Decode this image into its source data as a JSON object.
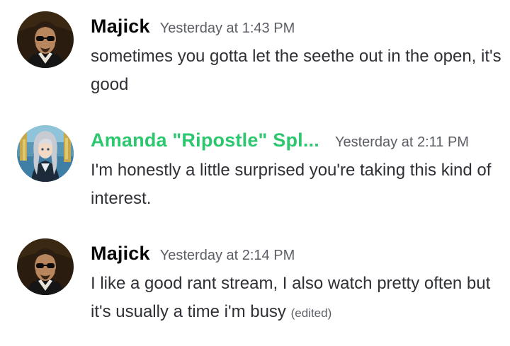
{
  "messages": [
    {
      "author": "Majick",
      "avatar_icon": "majick-avatar",
      "timestamp": "Yesterday at 1:43 PM",
      "text": "sometimes you gotta let the seethe out in the open, it's good",
      "edited": ""
    },
    {
      "author": "Amanda \"Ripostle\" Spl...",
      "author_color": "#2dc770",
      "avatar_icon": "amanda-avatar",
      "timestamp": "Yesterday at 2:11 PM",
      "text": "I'm honestly a little surprised you're taking this kind of interest.",
      "edited": ""
    },
    {
      "author": "Majick",
      "avatar_icon": "majick-avatar",
      "timestamp": "Yesterday at 2:14 PM",
      "text": "I like a good rant stream, I also watch pretty often but it's usually a time i'm busy",
      "edited": "(edited)"
    }
  ]
}
